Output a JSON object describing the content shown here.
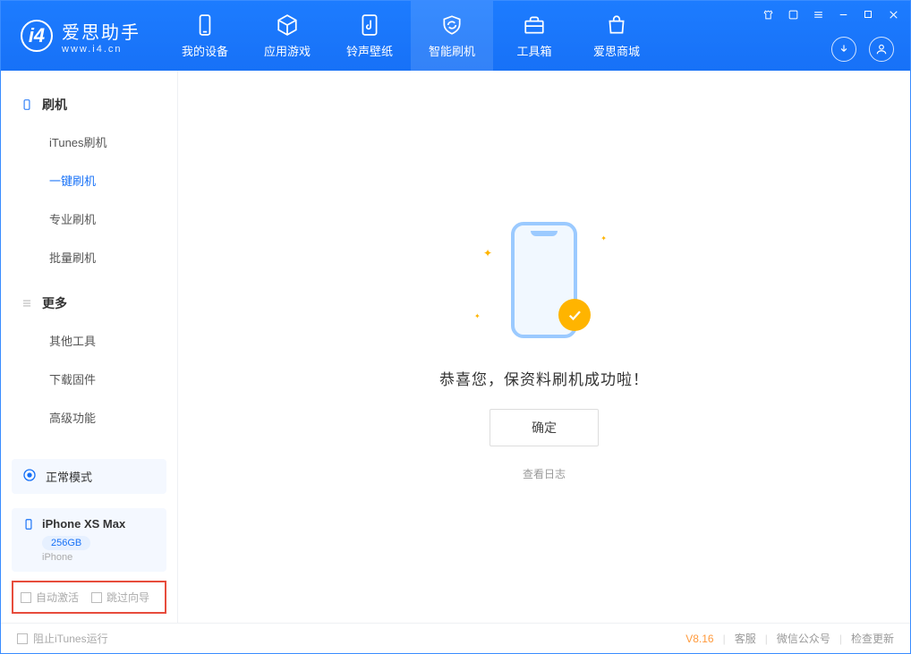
{
  "brand": {
    "name": "爱思助手",
    "url": "www.i4.cn",
    "logo_letter": "i4"
  },
  "nav": {
    "tabs": [
      {
        "label": "我的设备"
      },
      {
        "label": "应用游戏"
      },
      {
        "label": "铃声壁纸"
      },
      {
        "label": "智能刷机"
      },
      {
        "label": "工具箱"
      },
      {
        "label": "爱思商城"
      }
    ],
    "active_index": 3
  },
  "sidebar": {
    "groups": [
      {
        "title": "刷机",
        "items": [
          {
            "label": "iTunes刷机"
          },
          {
            "label": "一键刷机"
          },
          {
            "label": "专业刷机"
          },
          {
            "label": "批量刷机"
          }
        ],
        "active_index": 1
      },
      {
        "title": "更多",
        "items": [
          {
            "label": "其他工具"
          },
          {
            "label": "下载固件"
          },
          {
            "label": "高级功能"
          }
        ],
        "active_index": -1
      }
    ],
    "mode": {
      "label": "正常模式"
    },
    "device": {
      "name": "iPhone XS Max",
      "capacity": "256GB",
      "type": "iPhone"
    },
    "checks": {
      "auto_activate": "自动激活",
      "skip_guide": "跳过向导"
    }
  },
  "main": {
    "message": "恭喜您，保资料刷机成功啦！",
    "ok_label": "确定",
    "log_label": "查看日志"
  },
  "footer": {
    "block_itunes": "阻止iTunes运行",
    "version": "V8.16",
    "links": {
      "service": "客服",
      "wechat": "微信公众号",
      "update": "检查更新"
    }
  }
}
